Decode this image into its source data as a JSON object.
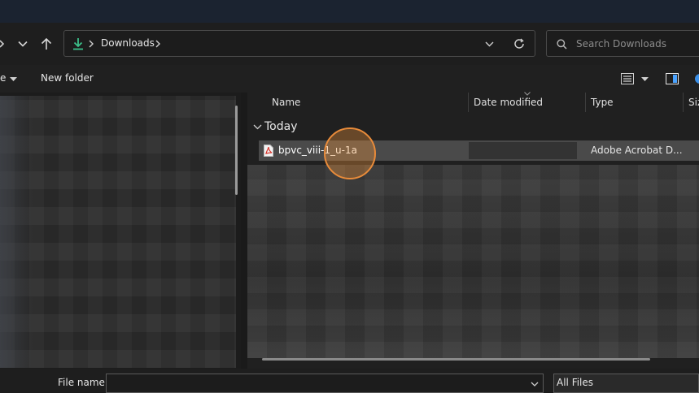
{
  "address_bar": {
    "location_icon": "download-arrow-icon",
    "path": [
      "Downloads"
    ],
    "search_placeholder": "Search Downloads"
  },
  "command_bar": {
    "left_partial_label": "e",
    "new_folder_label": "New folder"
  },
  "columns": [
    "Name",
    "Date modified",
    "Type",
    "Siz"
  ],
  "groups": [
    {
      "label": "Today",
      "files": [
        {
          "name": "bpvc_viii-1_u-1a",
          "date_modified": "",
          "type": "Adobe Acrobat D...",
          "icon": "pdf-file-icon"
        }
      ]
    }
  ],
  "bottom": {
    "file_name_label": "File name:",
    "file_name_value": "",
    "filter_value": "All Files"
  },
  "colors": {
    "accent_cursor": "#e88b3a",
    "download_icon": "#3cc08a",
    "pdf_icon": "#d9342b"
  }
}
